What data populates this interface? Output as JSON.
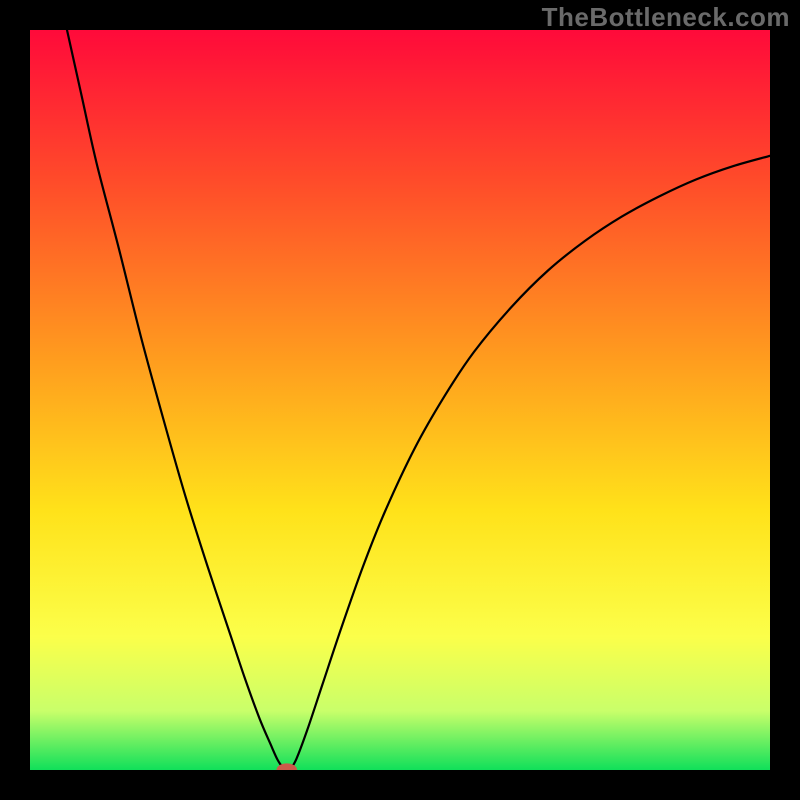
{
  "watermark": "TheBottleneck.com",
  "chart_data": {
    "type": "line",
    "title": "",
    "xlabel": "",
    "ylabel": "",
    "xlim": [
      0,
      100
    ],
    "ylim": [
      0,
      100
    ],
    "grid": false,
    "legend": false,
    "gradient_stops": [
      {
        "pos": 0.0,
        "color": "#ff0a3a"
      },
      {
        "pos": 0.2,
        "color": "#ff4a2a"
      },
      {
        "pos": 0.45,
        "color": "#ff9e1e"
      },
      {
        "pos": 0.65,
        "color": "#ffe21a"
      },
      {
        "pos": 0.82,
        "color": "#fbff4a"
      },
      {
        "pos": 0.92,
        "color": "#c9ff6a"
      },
      {
        "pos": 1.0,
        "color": "#10e05a"
      }
    ],
    "series": [
      {
        "name": "curve",
        "color": "#000000",
        "width": 2.2,
        "points": [
          {
            "x": 5.0,
            "y": 100.0
          },
          {
            "x": 7.0,
            "y": 91.0
          },
          {
            "x": 9.0,
            "y": 82.0
          },
          {
            "x": 12.0,
            "y": 70.5
          },
          {
            "x": 15.0,
            "y": 58.5
          },
          {
            "x": 18.0,
            "y": 47.5
          },
          {
            "x": 21.0,
            "y": 37.0
          },
          {
            "x": 24.0,
            "y": 27.5
          },
          {
            "x": 27.0,
            "y": 18.5
          },
          {
            "x": 29.0,
            "y": 12.5
          },
          {
            "x": 31.0,
            "y": 7.0
          },
          {
            "x": 32.5,
            "y": 3.5
          },
          {
            "x": 33.5,
            "y": 1.3
          },
          {
            "x": 34.3,
            "y": 0.3
          },
          {
            "x": 35.2,
            "y": 0.3
          },
          {
            "x": 36.0,
            "y": 1.5
          },
          {
            "x": 37.5,
            "y": 5.5
          },
          {
            "x": 39.5,
            "y": 11.5
          },
          {
            "x": 42.0,
            "y": 19.0
          },
          {
            "x": 45.0,
            "y": 27.5
          },
          {
            "x": 48.0,
            "y": 35.0
          },
          {
            "x": 52.0,
            "y": 43.5
          },
          {
            "x": 56.0,
            "y": 50.5
          },
          {
            "x": 60.0,
            "y": 56.5
          },
          {
            "x": 65.0,
            "y": 62.5
          },
          {
            "x": 70.0,
            "y": 67.5
          },
          {
            "x": 75.0,
            "y": 71.5
          },
          {
            "x": 80.0,
            "y": 74.8
          },
          {
            "x": 85.0,
            "y": 77.5
          },
          {
            "x": 90.0,
            "y": 79.8
          },
          {
            "x": 95.0,
            "y": 81.6
          },
          {
            "x": 100.0,
            "y": 83.0
          }
        ]
      }
    ],
    "marker": {
      "name": "min-point",
      "x": 34.7,
      "y": 0.0,
      "rx": 1.4,
      "ry": 0.9,
      "color": "#cb5a4a"
    }
  }
}
